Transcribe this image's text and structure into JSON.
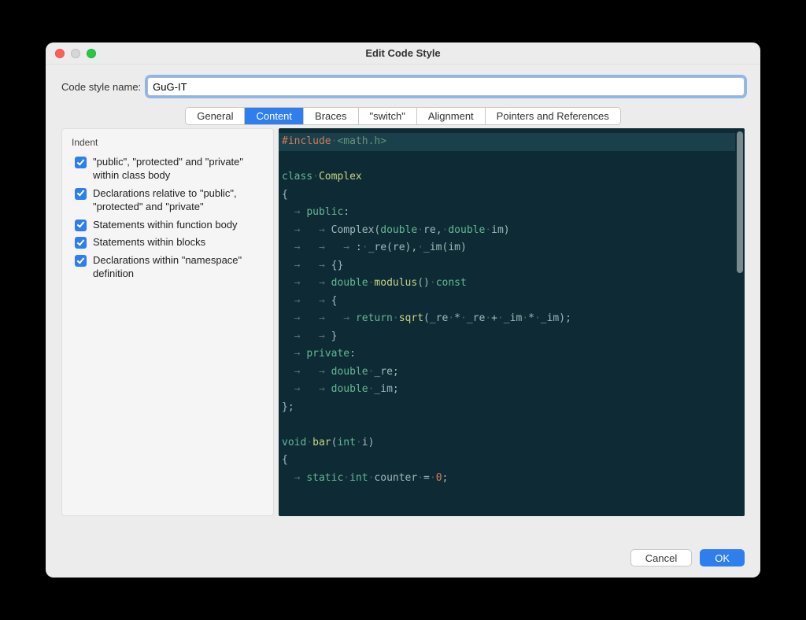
{
  "window": {
    "title": "Edit Code Style"
  },
  "nameRow": {
    "label": "Code style name:",
    "value": "GuG-IT"
  },
  "tabs": [
    {
      "label": "General",
      "active": false
    },
    {
      "label": "Content",
      "active": true
    },
    {
      "label": "Braces",
      "active": false
    },
    {
      "label": "\"switch\"",
      "active": false
    },
    {
      "label": "Alignment",
      "active": false
    },
    {
      "label": "Pointers and References",
      "active": false
    }
  ],
  "indent": {
    "title": "Indent",
    "options": [
      {
        "label": "\"public\", \"protected\" and \"private\" within class body",
        "checked": true
      },
      {
        "label": "Declarations relative to \"public\", \"protected\" and \"private\"",
        "checked": true
      },
      {
        "label": "Statements within function body",
        "checked": true
      },
      {
        "label": "Statements within blocks",
        "checked": true
      },
      {
        "label": "Declarations within \"namespace\" definition",
        "checked": true
      }
    ]
  },
  "code": {
    "lines": [
      [
        {
          "t": "pre",
          "v": "#include"
        },
        {
          "t": "dot",
          "v": "·"
        },
        {
          "t": "inc",
          "v": "<math.h>"
        }
      ],
      [],
      [
        {
          "t": "kw",
          "v": "class"
        },
        {
          "t": "dot",
          "v": "·"
        },
        {
          "t": "cls",
          "v": "Complex"
        }
      ],
      [
        {
          "t": "op",
          "v": "{"
        }
      ],
      [
        {
          "t": "arrow",
          "v": "  → "
        },
        {
          "t": "kw",
          "v": "public"
        },
        {
          "t": "op",
          "v": ":"
        }
      ],
      [
        {
          "t": "arrow",
          "v": "  →   → "
        },
        {
          "t": "op",
          "v": "Complex("
        },
        {
          "t": "kw",
          "v": "double"
        },
        {
          "t": "dot",
          "v": "·"
        },
        {
          "t": "op",
          "v": "re,"
        },
        {
          "t": "dot",
          "v": "·"
        },
        {
          "t": "kw",
          "v": "double"
        },
        {
          "t": "dot",
          "v": "·"
        },
        {
          "t": "op",
          "v": "im)"
        }
      ],
      [
        {
          "t": "arrow",
          "v": "  →   →   → "
        },
        {
          "t": "op",
          "v": ":"
        },
        {
          "t": "dot",
          "v": "·"
        },
        {
          "t": "op",
          "v": "_re(re),"
        },
        {
          "t": "dot",
          "v": "·"
        },
        {
          "t": "op",
          "v": "_im(im)"
        }
      ],
      [
        {
          "t": "arrow",
          "v": "  →   → "
        },
        {
          "t": "op",
          "v": "{}"
        }
      ],
      [
        {
          "t": "arrow",
          "v": "  →   → "
        },
        {
          "t": "kw",
          "v": "double"
        },
        {
          "t": "dot",
          "v": "·"
        },
        {
          "t": "fn",
          "v": "modulus"
        },
        {
          "t": "op",
          "v": "()"
        },
        {
          "t": "dot",
          "v": "·"
        },
        {
          "t": "kw",
          "v": "const"
        }
      ],
      [
        {
          "t": "arrow",
          "v": "  →   → "
        },
        {
          "t": "op",
          "v": "{"
        }
      ],
      [
        {
          "t": "arrow",
          "v": "  →   →   → "
        },
        {
          "t": "kw",
          "v": "return"
        },
        {
          "t": "dot",
          "v": "·"
        },
        {
          "t": "fn",
          "v": "sqrt"
        },
        {
          "t": "op",
          "v": "(_re"
        },
        {
          "t": "dot",
          "v": "·"
        },
        {
          "t": "op",
          "v": "*"
        },
        {
          "t": "dot",
          "v": "·"
        },
        {
          "t": "op",
          "v": "_re"
        },
        {
          "t": "dot",
          "v": "·"
        },
        {
          "t": "op",
          "v": "+"
        },
        {
          "t": "dot",
          "v": "·"
        },
        {
          "t": "op",
          "v": "_im"
        },
        {
          "t": "dot",
          "v": "·"
        },
        {
          "t": "op",
          "v": "*"
        },
        {
          "t": "dot",
          "v": "·"
        },
        {
          "t": "op",
          "v": "_im);"
        }
      ],
      [
        {
          "t": "arrow",
          "v": "  →   → "
        },
        {
          "t": "op",
          "v": "}"
        }
      ],
      [
        {
          "t": "arrow",
          "v": "  → "
        },
        {
          "t": "kw",
          "v": "private"
        },
        {
          "t": "op",
          "v": ":"
        }
      ],
      [
        {
          "t": "arrow",
          "v": "  →   → "
        },
        {
          "t": "kw",
          "v": "double"
        },
        {
          "t": "dot",
          "v": "·"
        },
        {
          "t": "op",
          "v": "_re;"
        }
      ],
      [
        {
          "t": "arrow",
          "v": "  →   → "
        },
        {
          "t": "kw",
          "v": "double"
        },
        {
          "t": "dot",
          "v": "·"
        },
        {
          "t": "op",
          "v": "_im;"
        }
      ],
      [
        {
          "t": "op",
          "v": "};"
        }
      ],
      [],
      [
        {
          "t": "kw",
          "v": "void"
        },
        {
          "t": "dot",
          "v": "·"
        },
        {
          "t": "fn",
          "v": "bar"
        },
        {
          "t": "op",
          "v": "("
        },
        {
          "t": "kw",
          "v": "int"
        },
        {
          "t": "dot",
          "v": "·"
        },
        {
          "t": "op",
          "v": "i)"
        }
      ],
      [
        {
          "t": "op",
          "v": "{"
        }
      ],
      [
        {
          "t": "arrow",
          "v": "  → "
        },
        {
          "t": "kw",
          "v": "static"
        },
        {
          "t": "dot",
          "v": "·"
        },
        {
          "t": "kw",
          "v": "int"
        },
        {
          "t": "dot",
          "v": "·"
        },
        {
          "t": "op",
          "v": "counter"
        },
        {
          "t": "dot",
          "v": "·"
        },
        {
          "t": "op",
          "v": "="
        },
        {
          "t": "dot",
          "v": "·"
        },
        {
          "t": "num",
          "v": "0"
        },
        {
          "t": "op",
          "v": ";"
        }
      ]
    ]
  },
  "footer": {
    "cancel": "Cancel",
    "ok": "OK"
  }
}
